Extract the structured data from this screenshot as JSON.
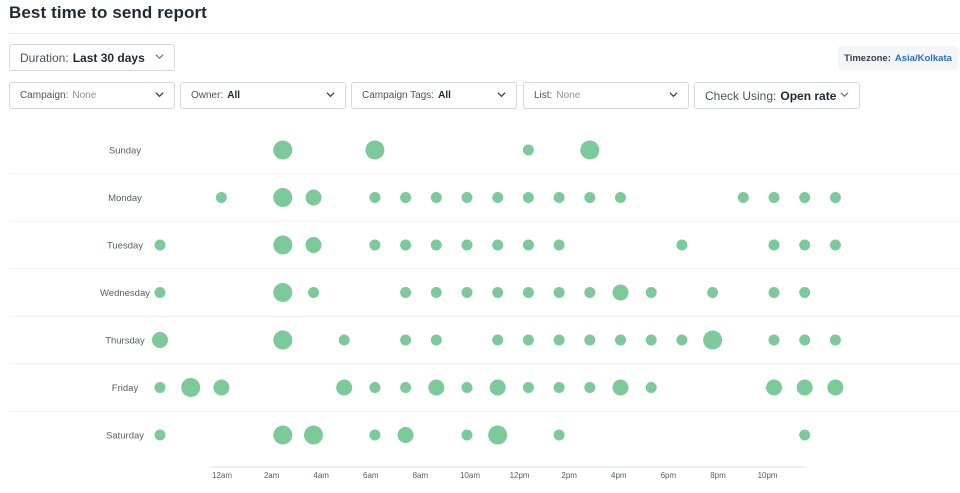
{
  "page": {
    "title": "Best time to send report"
  },
  "filters": {
    "duration": {
      "label": "Duration:",
      "value": "Last 30 days"
    },
    "campaign": {
      "label": "Campaign:",
      "value": "None"
    },
    "owner": {
      "label": "Owner:",
      "value": "All"
    },
    "campaign_tags": {
      "label": "Campaign Tags:",
      "value": "All"
    },
    "list": {
      "label": "List:",
      "value": "None"
    },
    "check_using": {
      "label": "Check Using:",
      "value": "Open rate"
    }
  },
  "timezone": {
    "label": "Timezone:",
    "value": "Asia/Kolkata"
  },
  "colors": {
    "dot": "#7cc99a",
    "grid": "#eef0f2",
    "axis": "#d8dde2",
    "text": "#555f69"
  },
  "chart_data": {
    "type": "scatter",
    "title": "",
    "xlabel": "",
    "ylabel": "",
    "x_tick_labels": [
      "12am",
      "2am",
      "4am",
      "6am",
      "8am",
      "10am",
      "12pm",
      "2pm",
      "4pm",
      "6pm",
      "8pm",
      "10pm"
    ],
    "x_tick_hours": [
      0,
      2,
      4,
      6,
      8,
      10,
      12,
      14,
      16,
      18,
      20,
      22
    ],
    "y_categories": [
      "Sunday",
      "Monday",
      "Tuesday",
      "Wednesday",
      "Thursday",
      "Friday",
      "Saturday"
    ],
    "size_scale": "relative (1 = smallest, 4 = largest)",
    "points": [
      {
        "day": "Sunday",
        "hour": 3,
        "size": 3
      },
      {
        "day": "Sunday",
        "hour": 6,
        "size": 3
      },
      {
        "day": "Sunday",
        "hour": 11,
        "size": 1
      },
      {
        "day": "Sunday",
        "hour": 13,
        "size": 3
      },
      {
        "day": "Monday",
        "hour": 1,
        "size": 1
      },
      {
        "day": "Monday",
        "hour": 3,
        "size": 3
      },
      {
        "day": "Monday",
        "hour": 4,
        "size": 2
      },
      {
        "day": "Monday",
        "hour": 6,
        "size": 1
      },
      {
        "day": "Monday",
        "hour": 7,
        "size": 1
      },
      {
        "day": "Monday",
        "hour": 8,
        "size": 1
      },
      {
        "day": "Monday",
        "hour": 9,
        "size": 1
      },
      {
        "day": "Monday",
        "hour": 10,
        "size": 1
      },
      {
        "day": "Monday",
        "hour": 11,
        "size": 1
      },
      {
        "day": "Monday",
        "hour": 12,
        "size": 1
      },
      {
        "day": "Monday",
        "hour": 13,
        "size": 1
      },
      {
        "day": "Monday",
        "hour": 14,
        "size": 1
      },
      {
        "day": "Monday",
        "hour": 18,
        "size": 1
      },
      {
        "day": "Monday",
        "hour": 19,
        "size": 1
      },
      {
        "day": "Monday",
        "hour": 20,
        "size": 1
      },
      {
        "day": "Monday",
        "hour": 21,
        "size": 1
      },
      {
        "day": "Tuesday",
        "hour": -1,
        "size": 1
      },
      {
        "day": "Tuesday",
        "hour": 3,
        "size": 3
      },
      {
        "day": "Tuesday",
        "hour": 4,
        "size": 2
      },
      {
        "day": "Tuesday",
        "hour": 6,
        "size": 1
      },
      {
        "day": "Tuesday",
        "hour": 7,
        "size": 1
      },
      {
        "day": "Tuesday",
        "hour": 8,
        "size": 1
      },
      {
        "day": "Tuesday",
        "hour": 9,
        "size": 1
      },
      {
        "day": "Tuesday",
        "hour": 10,
        "size": 1
      },
      {
        "day": "Tuesday",
        "hour": 11,
        "size": 1
      },
      {
        "day": "Tuesday",
        "hour": 12,
        "size": 1
      },
      {
        "day": "Tuesday",
        "hour": 16,
        "size": 1
      },
      {
        "day": "Tuesday",
        "hour": 19,
        "size": 1
      },
      {
        "day": "Tuesday",
        "hour": 20,
        "size": 1
      },
      {
        "day": "Tuesday",
        "hour": 21,
        "size": 1
      },
      {
        "day": "Wednesday",
        "hour": -1,
        "size": 1
      },
      {
        "day": "Wednesday",
        "hour": 3,
        "size": 3
      },
      {
        "day": "Wednesday",
        "hour": 4,
        "size": 1
      },
      {
        "day": "Wednesday",
        "hour": 7,
        "size": 1
      },
      {
        "day": "Wednesday",
        "hour": 8,
        "size": 1
      },
      {
        "day": "Wednesday",
        "hour": 9,
        "size": 1
      },
      {
        "day": "Wednesday",
        "hour": 10,
        "size": 1
      },
      {
        "day": "Wednesday",
        "hour": 11,
        "size": 1
      },
      {
        "day": "Wednesday",
        "hour": 12,
        "size": 1
      },
      {
        "day": "Wednesday",
        "hour": 13,
        "size": 1
      },
      {
        "day": "Wednesday",
        "hour": 14,
        "size": 2
      },
      {
        "day": "Wednesday",
        "hour": 15,
        "size": 1
      },
      {
        "day": "Wednesday",
        "hour": 17,
        "size": 1
      },
      {
        "day": "Wednesday",
        "hour": 19,
        "size": 1
      },
      {
        "day": "Wednesday",
        "hour": 20,
        "size": 1
      },
      {
        "day": "Thursday",
        "hour": -1,
        "size": 2
      },
      {
        "day": "Thursday",
        "hour": 3,
        "size": 3
      },
      {
        "day": "Thursday",
        "hour": 5,
        "size": 1
      },
      {
        "day": "Thursday",
        "hour": 7,
        "size": 1
      },
      {
        "day": "Thursday",
        "hour": 8,
        "size": 1
      },
      {
        "day": "Thursday",
        "hour": 10,
        "size": 1
      },
      {
        "day": "Thursday",
        "hour": 11,
        "size": 1
      },
      {
        "day": "Thursday",
        "hour": 12,
        "size": 1
      },
      {
        "day": "Thursday",
        "hour": 13,
        "size": 1
      },
      {
        "day": "Thursday",
        "hour": 14,
        "size": 1
      },
      {
        "day": "Thursday",
        "hour": 15,
        "size": 1
      },
      {
        "day": "Thursday",
        "hour": 16,
        "size": 1
      },
      {
        "day": "Thursday",
        "hour": 17,
        "size": 3
      },
      {
        "day": "Thursday",
        "hour": 19,
        "size": 1
      },
      {
        "day": "Thursday",
        "hour": 20,
        "size": 1
      },
      {
        "day": "Thursday",
        "hour": 21,
        "size": 1
      },
      {
        "day": "Friday",
        "hour": -1,
        "size": 1
      },
      {
        "day": "Friday",
        "hour": 0,
        "size": 3
      },
      {
        "day": "Friday",
        "hour": 1,
        "size": 2
      },
      {
        "day": "Friday",
        "hour": 5,
        "size": 2
      },
      {
        "day": "Friday",
        "hour": 6,
        "size": 1
      },
      {
        "day": "Friday",
        "hour": 7,
        "size": 1
      },
      {
        "day": "Friday",
        "hour": 8,
        "size": 2
      },
      {
        "day": "Friday",
        "hour": 9,
        "size": 1
      },
      {
        "day": "Friday",
        "hour": 10,
        "size": 2
      },
      {
        "day": "Friday",
        "hour": 11,
        "size": 1
      },
      {
        "day": "Friday",
        "hour": 12,
        "size": 1
      },
      {
        "day": "Friday",
        "hour": 13,
        "size": 1
      },
      {
        "day": "Friday",
        "hour": 14,
        "size": 2
      },
      {
        "day": "Friday",
        "hour": 15,
        "size": 1
      },
      {
        "day": "Friday",
        "hour": 19,
        "size": 2
      },
      {
        "day": "Friday",
        "hour": 20,
        "size": 2
      },
      {
        "day": "Friday",
        "hour": 21,
        "size": 2
      },
      {
        "day": "Saturday",
        "hour": -1,
        "size": 1
      },
      {
        "day": "Saturday",
        "hour": 3,
        "size": 3
      },
      {
        "day": "Saturday",
        "hour": 4,
        "size": 3
      },
      {
        "day": "Saturday",
        "hour": 6,
        "size": 1
      },
      {
        "day": "Saturday",
        "hour": 7,
        "size": 2
      },
      {
        "day": "Saturday",
        "hour": 9,
        "size": 1
      },
      {
        "day": "Saturday",
        "hour": 10,
        "size": 3
      },
      {
        "day": "Saturday",
        "hour": 12,
        "size": 1
      },
      {
        "day": "Saturday",
        "hour": 20,
        "size": 1
      }
    ]
  }
}
